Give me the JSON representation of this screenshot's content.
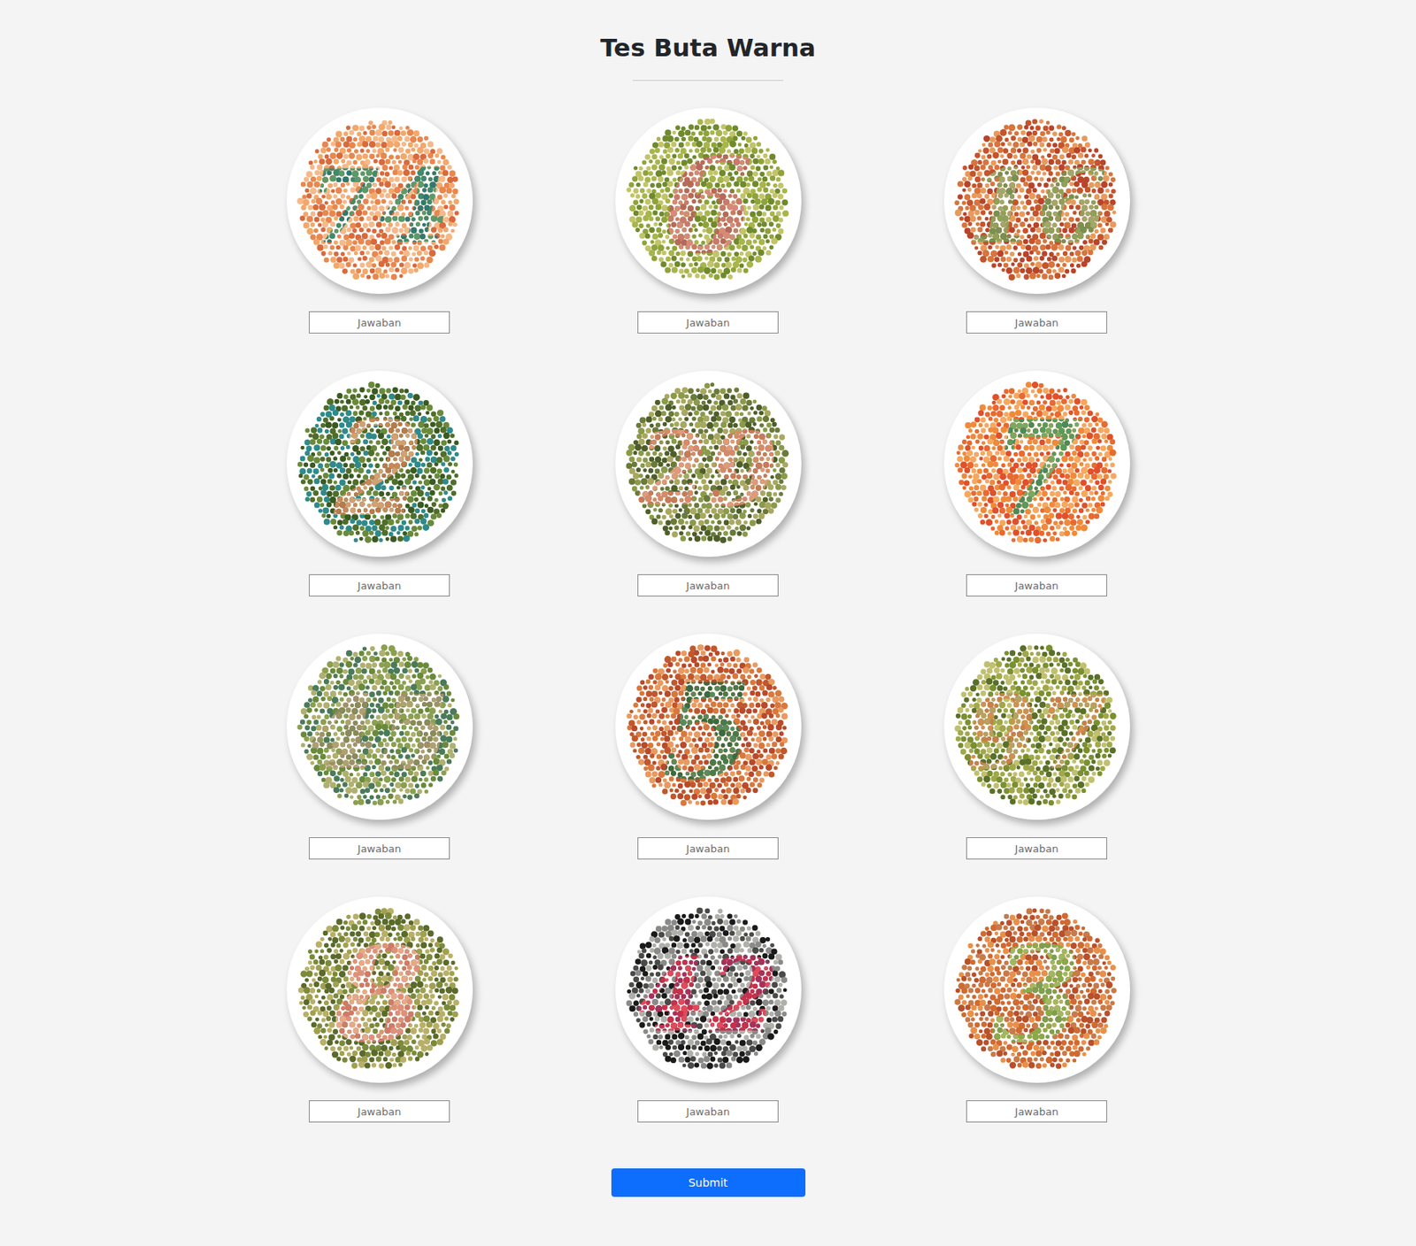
{
  "page": {
    "title": "Tes Buta Warna"
  },
  "plates": [
    {
      "figure": "74",
      "ground": [
        "#e8874f",
        "#f2a86a",
        "#d96a3c",
        "#f5b98a"
      ],
      "ink": [
        "#3f8a6e",
        "#2f7a70",
        "#5a9a6a"
      ],
      "answer": {
        "placeholder": "Jawaban",
        "value": ""
      }
    },
    {
      "figure": "6",
      "ground": [
        "#8fa33a",
        "#a8b54a",
        "#6f8a2c",
        "#c2c46a"
      ],
      "ink": [
        "#c97a6a",
        "#d68a78",
        "#b8685a"
      ],
      "answer": {
        "placeholder": "Jawaban",
        "value": ""
      }
    },
    {
      "figure": "16",
      "ground": [
        "#d8743c",
        "#c4542c",
        "#e89a5c",
        "#b8442a"
      ],
      "ink": [
        "#8fa05a",
        "#a0a86a",
        "#7a9050"
      ],
      "answer": {
        "placeholder": "Jawaban",
        "value": ""
      }
    },
    {
      "figure": "2",
      "ground": [
        "#4f6e2a",
        "#6a8a3a",
        "#2f8a8a",
        "#3a5a20"
      ],
      "ink": [
        "#c8885a",
        "#b87a4a",
        "#d4a070"
      ],
      "answer": {
        "placeholder": "Jawaban",
        "value": ""
      }
    },
    {
      "figure": "29",
      "ground": [
        "#6a7a3a",
        "#8a9a4a",
        "#4e5e2a",
        "#a8a860"
      ],
      "ink": [
        "#d68a6a",
        "#c87a5a",
        "#e09a7a"
      ],
      "answer": {
        "placeholder": "Jawaban",
        "value": ""
      }
    },
    {
      "figure": "7",
      "ground": [
        "#f08a3a",
        "#e86a30",
        "#f5a860",
        "#e0502a"
      ],
      "ink": [
        "#5a9a5a",
        "#7aa860",
        "#4a8a5a"
      ],
      "answer": {
        "placeholder": "Jawaban",
        "value": ""
      }
    },
    {
      "figure": "45",
      "ground": [
        "#8aa050",
        "#6a8a3a",
        "#b0b070",
        "#4a7a5a"
      ],
      "ink": [
        "#a0906a",
        "#8a8a5a",
        "#b0a070"
      ],
      "answer": {
        "placeholder": "Jawaban",
        "value": ""
      }
    },
    {
      "figure": "5",
      "ground": [
        "#d8783c",
        "#c0582c",
        "#e89a60",
        "#b84a2a"
      ],
      "ink": [
        "#4a7a4a",
        "#5a8a5a",
        "#3a6a40"
      ],
      "answer": {
        "placeholder": "Jawaban",
        "value": ""
      }
    },
    {
      "figure": "97",
      "ground": [
        "#7a9030",
        "#a0a848",
        "#5a7028",
        "#c0c070"
      ],
      "ink": [
        "#d09050",
        "#c88048",
        "#b8a060"
      ],
      "answer": {
        "placeholder": "Jawaban",
        "value": ""
      }
    },
    {
      "figure": "8",
      "ground": [
        "#7a8a3a",
        "#a0a050",
        "#5a6a2a",
        "#b8b068"
      ],
      "ink": [
        "#e0907a",
        "#d07a68",
        "#e8a888"
      ],
      "answer": {
        "placeholder": "Jawaban",
        "value": ""
      }
    },
    {
      "figure": "42",
      "ground": [
        "#1a1a1a",
        "#8a8a88",
        "#b0b0aa",
        "#4a4a48"
      ],
      "ink": [
        "#c8304a",
        "#e04a5a",
        "#a8305a"
      ],
      "answer": {
        "placeholder": "Jawaban",
        "value": ""
      }
    },
    {
      "figure": "3",
      "ground": [
        "#d06a30",
        "#b8502a",
        "#e8904a",
        "#c87a4a"
      ],
      "ink": [
        "#8aaa48",
        "#a0b860",
        "#7aa050"
      ],
      "answer": {
        "placeholder": "Jawaban",
        "value": ""
      }
    }
  ],
  "submit": {
    "label": "Submit"
  }
}
